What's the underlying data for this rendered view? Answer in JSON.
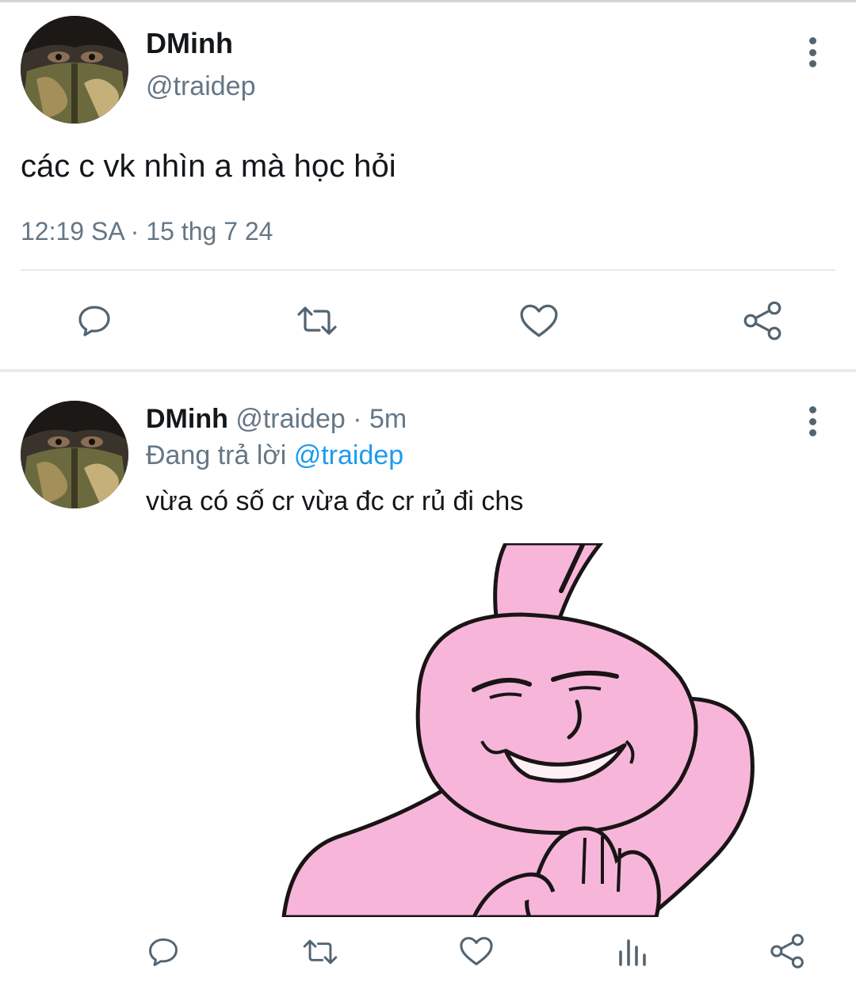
{
  "main_tweet": {
    "author_name": "DMinh",
    "handle": "@traidep",
    "text": "các c vk nhìn a mà học hỏi",
    "timestamp": "12:19 SA · 15 thg 7 24",
    "actions": [
      "reply-icon",
      "retweet-icon",
      "like-icon",
      "share-icon"
    ]
  },
  "reply_tweet": {
    "author_name": "DMinh",
    "handle_time": "@traidep · 5m",
    "replying_prefix": "Đang trả lời",
    "replying_to": "@traidep",
    "text": "vừa có số cr vừa đc cr rủ đi chs",
    "media": "pink-rabbit-meme-image",
    "actions": [
      "reply-icon",
      "retweet-icon",
      "like-icon",
      "analytics-icon",
      "share-icon"
    ]
  },
  "colors": {
    "text_primary": "#14171a",
    "text_secondary": "#657786",
    "link": "#1d9bf0",
    "icon": "#536471",
    "rabbit_pink": "#f7b6d9"
  }
}
